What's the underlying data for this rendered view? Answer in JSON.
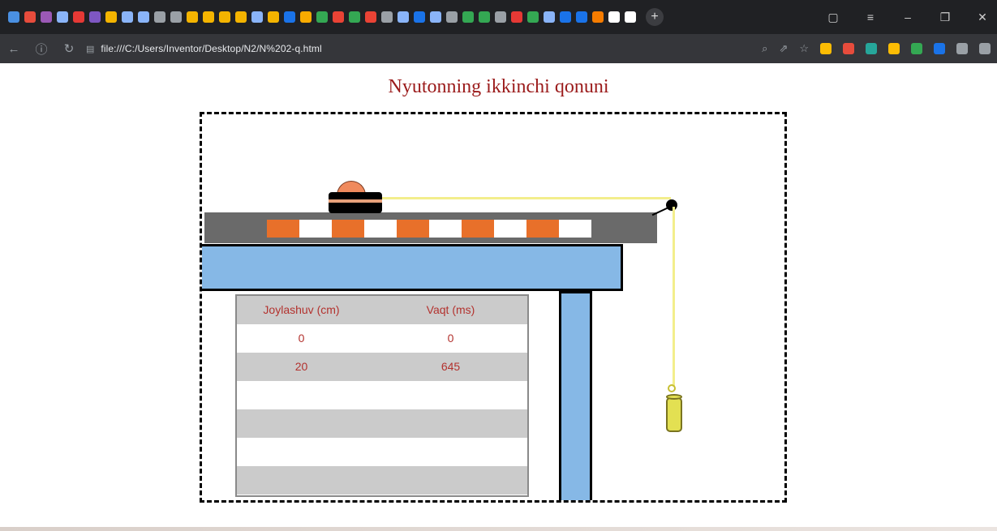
{
  "browser": {
    "url": "file:///C:/Users/Inventor/Desktop/N2/N%202-q.html",
    "tab_icons": [
      "#4a90e2",
      "#e74c3c",
      "#9b59b6",
      "#8ab4f8",
      "#e53935",
      "#7e57c2",
      "#f4b400",
      "#8ab4f8",
      "#8ab4f8",
      "#9aa0a6",
      "#9aa0a6",
      "#f4b400",
      "#f4b400",
      "#f4b400",
      "#f4b400",
      "#8ab4f8",
      "#f4b400",
      "#1a73e8",
      "#f9ab00",
      "#34a853",
      "#ea4335",
      "#34a853",
      "#ea4335",
      "#9aa0a6",
      "#8ab4f8",
      "#1a73e8",
      "#8ab4f8",
      "#9aa0a6",
      "#34a853",
      "#34a853",
      "#9aa0a6",
      "#e53935",
      "#34a853",
      "#8ab4f8",
      "#1a73e8",
      "#1a73e8",
      "#f57c00",
      "#ffffff",
      "#ffffff"
    ],
    "new_tab": "+",
    "window_controls": [
      "minimize-icon",
      "maximize-icon",
      "close-icon"
    ],
    "extension_colors": [
      "#fbbc04",
      "#e74c3c",
      "#26a69a",
      "#fbbc04",
      "#34a853",
      "#1a73e8",
      "#9aa0a6",
      "#9aa0a6"
    ]
  },
  "page": {
    "title": "Nyutonning ikkinchi qonuni"
  },
  "simulation": {
    "stripe_colors": [
      "#e8702a",
      "#ffffff",
      "#e8702a",
      "#ffffff",
      "#e8702a",
      "#ffffff",
      "#e8702a",
      "#ffffff",
      "#e8702a",
      "#ffffff"
    ],
    "table": {
      "headers": [
        "Joylashuv (cm)",
        "Vaqt (ms)"
      ],
      "rows": [
        [
          "0",
          "0"
        ],
        [
          "20",
          "645"
        ],
        [
          "",
          ""
        ],
        [
          "",
          ""
        ],
        [
          "",
          ""
        ],
        [
          "",
          ""
        ]
      ]
    }
  }
}
